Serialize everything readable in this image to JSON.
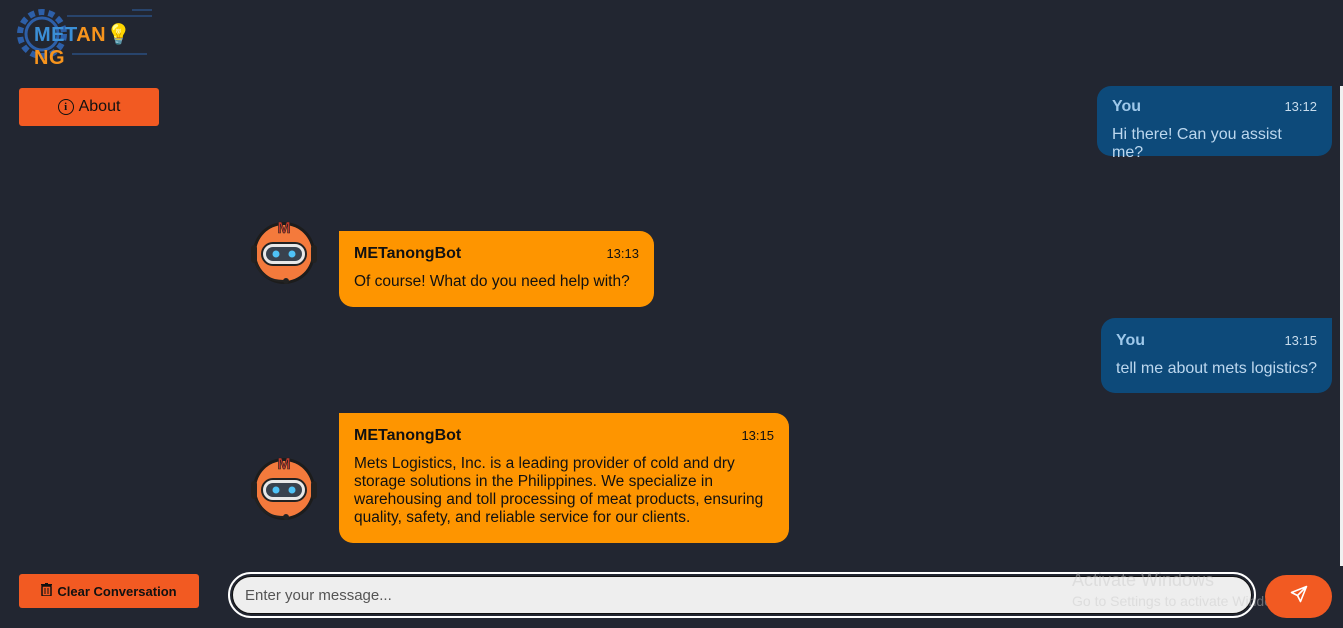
{
  "app": {
    "logo_text_part1": "MET",
    "logo_text_part2": "AN",
    "logo_text_part3": "NG"
  },
  "sidebar": {
    "about_label": "About",
    "clear_label": "Clear Conversation"
  },
  "messages": [
    {
      "sender": "You",
      "time": "13:12",
      "text": "Hi there! Can you assist me?"
    },
    {
      "sender": "METanongBot",
      "time": "13:13",
      "text": "Of course! What do you need help with?"
    },
    {
      "sender": "You",
      "time": "13:15",
      "text": "tell me about mets logistics?"
    },
    {
      "sender": "METanongBot",
      "time": "13:15",
      "text": "Mets Logistics, Inc. is a leading provider of cold and dry storage solutions in the Philippines. We specialize in warehousing and toll processing of meat products, ensuring quality, safety, and reliable service for our clients."
    }
  ],
  "composer": {
    "placeholder": "Enter your message..."
  },
  "watermark": {
    "line1": "Activate Windows",
    "line2": "Go to Settings to activate Windows."
  },
  "colors": {
    "background": "#222631",
    "accent": "#f25a22",
    "bot_bubble": "#fe9500",
    "user_bubble": "#0d4a7a"
  },
  "icons": {
    "about": "info-icon",
    "clear": "trash-icon",
    "send": "send-icon",
    "avatar": "robot-avatar-icon"
  }
}
